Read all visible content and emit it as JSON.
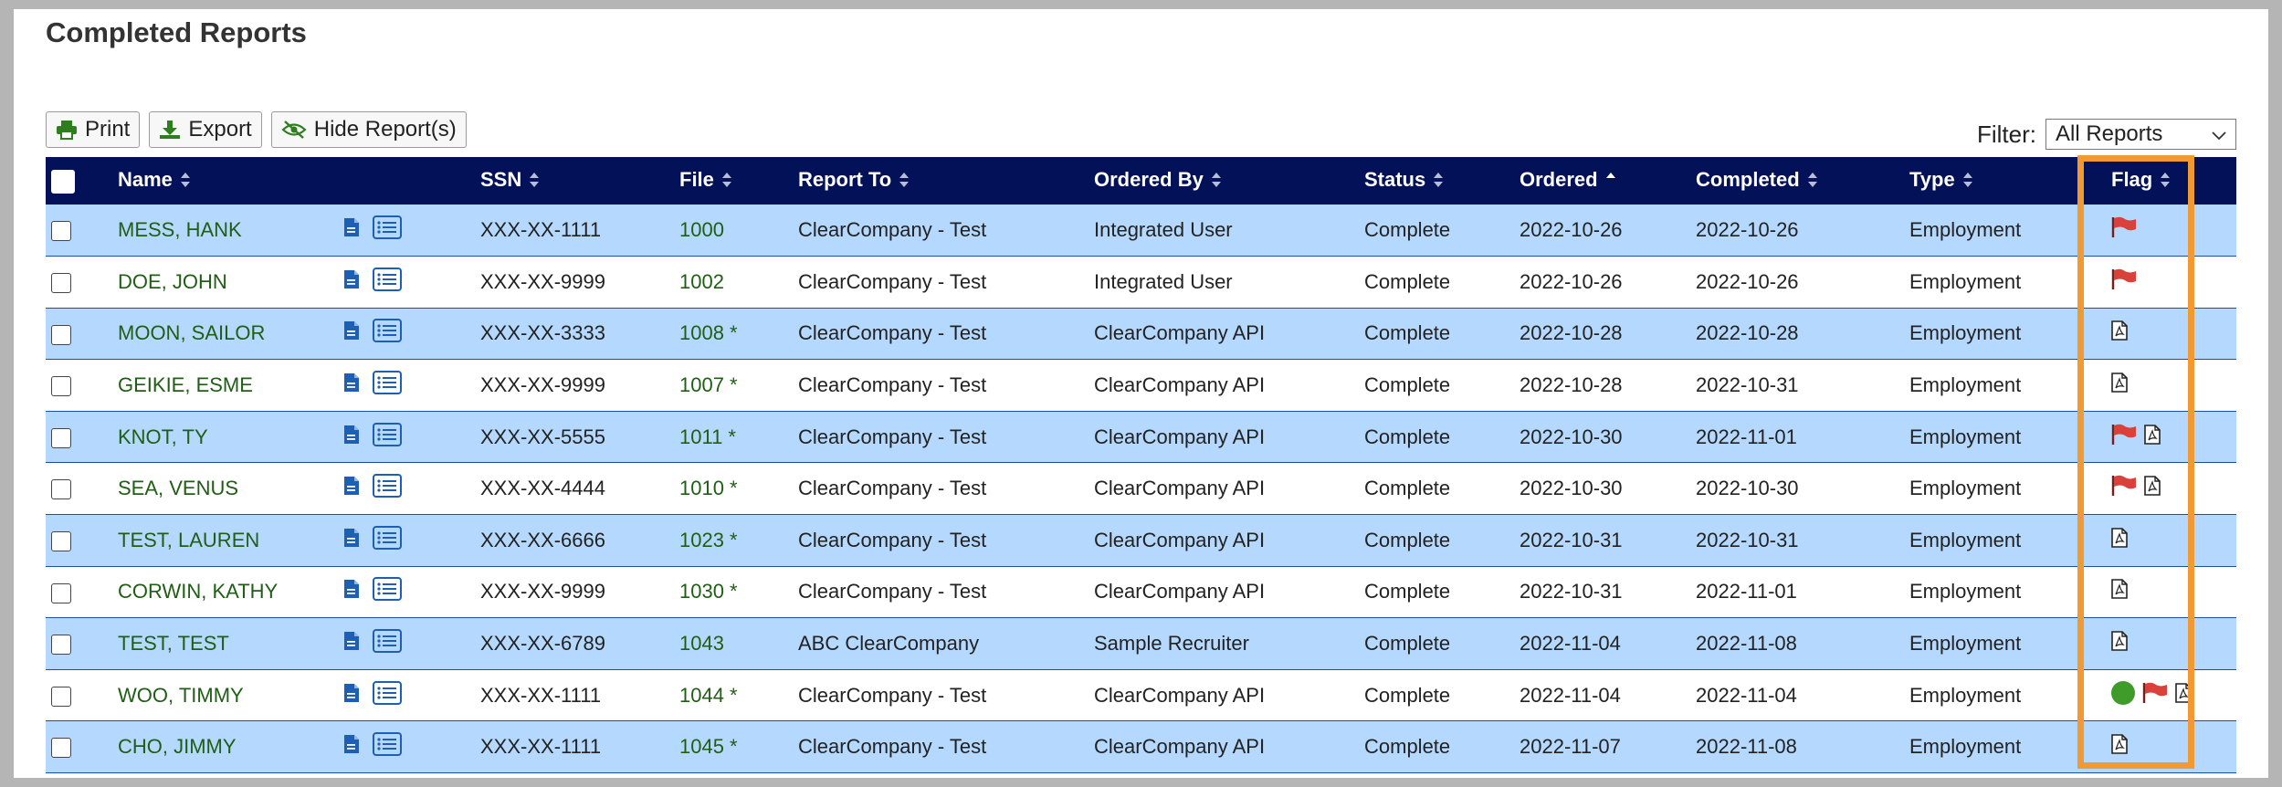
{
  "page": {
    "title": "Completed Reports"
  },
  "toolbar": {
    "print_label": "Print",
    "export_label": "Export",
    "hide_label": "Hide Report(s)"
  },
  "filter": {
    "label": "Filter:",
    "selected": "All Reports"
  },
  "table": {
    "columns": [
      "Name",
      "SSN",
      "File",
      "Report To",
      "Ordered By",
      "Status",
      "Ordered",
      "Completed",
      "Type",
      "Flag"
    ],
    "sorted_column": "Ordered",
    "rows": [
      {
        "name": "MESS, HANK",
        "ssn": "XXX-XX-1111",
        "file": "1000",
        "report_to": "ClearCompany - Test",
        "ordered_by": "Integrated User",
        "status": "Complete",
        "ordered": "2022-10-26",
        "completed": "2022-10-26",
        "type": "Employment",
        "flags": [
          "flag-icon"
        ]
      },
      {
        "name": "DOE, JOHN",
        "ssn": "XXX-XX-9999",
        "file": "1002",
        "report_to": "ClearCompany - Test",
        "ordered_by": "Integrated User",
        "status": "Complete",
        "ordered": "2022-10-26",
        "completed": "2022-10-26",
        "type": "Employment",
        "flags": [
          "flag-icon"
        ]
      },
      {
        "name": "MOON, SAILOR",
        "ssn": "XXX-XX-3333",
        "file": "1008 *",
        "report_to": "ClearCompany - Test",
        "ordered_by": "ClearCompany API",
        "status": "Complete",
        "ordered": "2022-10-28",
        "completed": "2022-10-28",
        "type": "Employment",
        "flags": [
          "pdf-icon"
        ]
      },
      {
        "name": "GEIKIE, ESME",
        "ssn": "XXX-XX-9999",
        "file": "1007 *",
        "report_to": "ClearCompany - Test",
        "ordered_by": "ClearCompany API",
        "status": "Complete",
        "ordered": "2022-10-28",
        "completed": "2022-10-31",
        "type": "Employment",
        "flags": [
          "pdf-icon"
        ]
      },
      {
        "name": "KNOT, TY",
        "ssn": "XXX-XX-5555",
        "file": "1011 *",
        "report_to": "ClearCompany - Test",
        "ordered_by": "ClearCompany API",
        "status": "Complete",
        "ordered": "2022-10-30",
        "completed": "2022-11-01",
        "type": "Employment",
        "flags": [
          "flag-icon",
          "pdf-icon"
        ]
      },
      {
        "name": "SEA, VENUS",
        "ssn": "XXX-XX-4444",
        "file": "1010 *",
        "report_to": "ClearCompany - Test",
        "ordered_by": "ClearCompany API",
        "status": "Complete",
        "ordered": "2022-10-30",
        "completed": "2022-10-30",
        "type": "Employment",
        "flags": [
          "flag-icon",
          "pdf-icon"
        ]
      },
      {
        "name": "TEST, LAUREN",
        "ssn": "XXX-XX-6666",
        "file": "1023 *",
        "report_to": "ClearCompany - Test",
        "ordered_by": "ClearCompany API",
        "status": "Complete",
        "ordered": "2022-10-31",
        "completed": "2022-10-31",
        "type": "Employment",
        "flags": [
          "pdf-icon"
        ]
      },
      {
        "name": "CORWIN, KATHY",
        "ssn": "XXX-XX-9999",
        "file": "1030 *",
        "report_to": "ClearCompany - Test",
        "ordered_by": "ClearCompany API",
        "status": "Complete",
        "ordered": "2022-10-31",
        "completed": "2022-11-01",
        "type": "Employment",
        "flags": [
          "pdf-icon"
        ]
      },
      {
        "name": "TEST, TEST",
        "ssn": "XXX-XX-6789",
        "file": "1043",
        "report_to": "ABC ClearCompany",
        "ordered_by": "Sample Recruiter",
        "status": "Complete",
        "ordered": "2022-11-04",
        "completed": "2022-11-08",
        "type": "Employment",
        "flags": [
          "pdf-icon"
        ]
      },
      {
        "name": "WOO, TIMMY",
        "ssn": "XXX-XX-1111",
        "file": "1044 *",
        "report_to": "ClearCompany - Test",
        "ordered_by": "ClearCompany API",
        "status": "Complete",
        "ordered": "2022-11-04",
        "completed": "2022-11-04",
        "type": "Employment",
        "flags": [
          "status-dot-icon",
          "flag-icon",
          "pdf-icon"
        ]
      },
      {
        "name": "CHO, JIMMY",
        "ssn": "XXX-XX-1111",
        "file": "1045 *",
        "report_to": "ClearCompany - Test",
        "ordered_by": "ClearCompany API",
        "status": "Complete",
        "ordered": "2022-11-07",
        "completed": "2022-11-08",
        "type": "Employment",
        "flags": [
          "pdf-icon"
        ]
      }
    ]
  },
  "colors": {
    "header_bg": "#031158",
    "row_highlight": "#b5d9fe",
    "name_text": "#1f5e14",
    "flag_red": "#d9413a",
    "status_green": "#3f9b2a",
    "callout_orange": "#f19a34",
    "toolbar_icon_green": "#2e7d1f"
  }
}
